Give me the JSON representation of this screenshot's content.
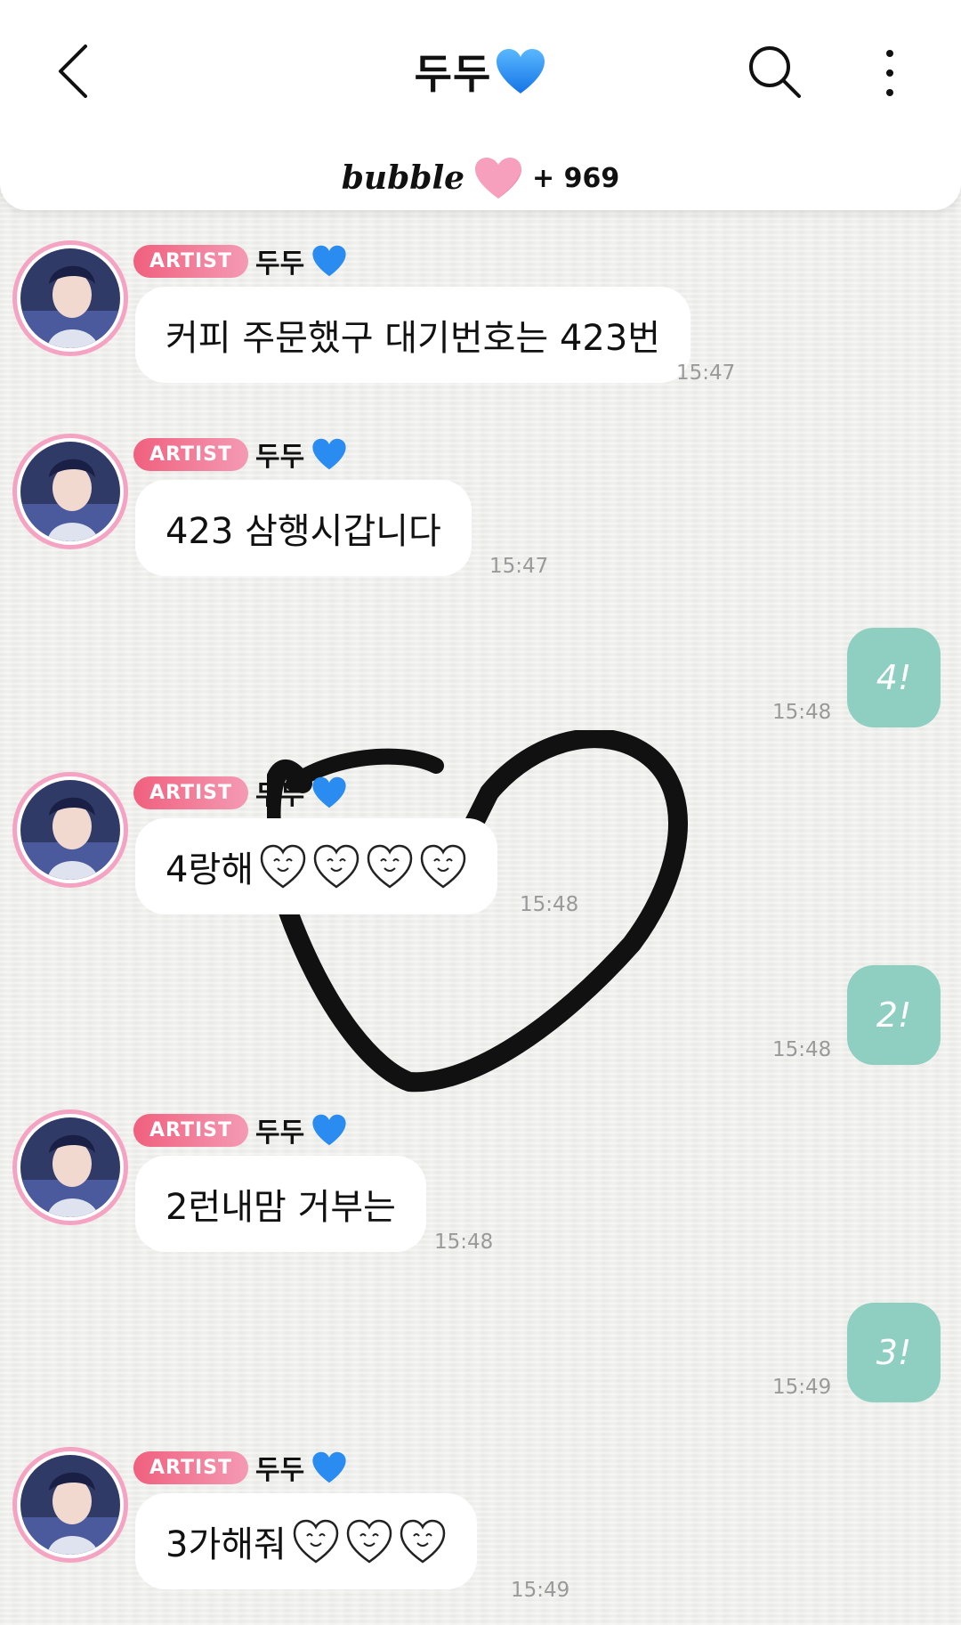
{
  "header": {
    "title": "두두",
    "brand": "bubble",
    "count": "+ 969"
  },
  "colors": {
    "artist_badge": "#f0607e",
    "my_bubble": "#8fcfc2",
    "avatar_ring": "#f5a3c2",
    "blue_heart": "#1e90ff",
    "pink_heart": "#f7a0bd"
  },
  "icons": [
    "chevron-left-icon",
    "blue-heart-icon",
    "search-icon",
    "more-vertical-icon",
    "pink-heart-icon",
    "smiling-heart-icon"
  ],
  "messages": [
    {
      "type": "artist",
      "badge": "ARTIST",
      "name": "두두",
      "text": "커피 주문했구 대기번호는 423번",
      "hearts": 0,
      "time": "15:47"
    },
    {
      "type": "artist",
      "badge": "ARTIST",
      "name": "두두",
      "text": "423 삼행시갑니다",
      "hearts": 0,
      "time": "15:47"
    },
    {
      "type": "mine",
      "text": "4!",
      "time": "15:48"
    },
    {
      "type": "artist",
      "badge": "ARTIST",
      "name": "두두",
      "text": "4랑해",
      "hearts": 4,
      "time": "15:48"
    },
    {
      "type": "mine",
      "text": "2!",
      "time": "15:48"
    },
    {
      "type": "artist",
      "badge": "ARTIST",
      "name": "두두",
      "text": "2런내맘 거부는",
      "hearts": 0,
      "time": "15:48"
    },
    {
      "type": "mine",
      "text": "3!",
      "time": "15:49"
    },
    {
      "type": "artist",
      "badge": "ARTIST",
      "name": "두두",
      "text": "3가해줘",
      "hearts": 3,
      "time": "15:49"
    }
  ]
}
